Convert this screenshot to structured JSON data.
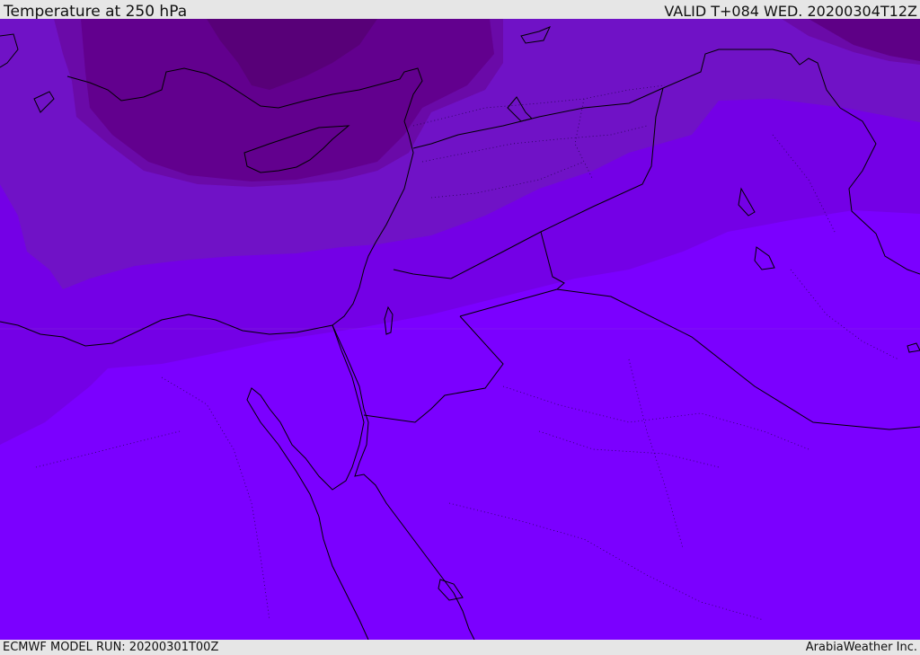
{
  "header": {
    "title": "Temperature at 250 hPa",
    "valid": "VALID T+084 WED. 20200304T12Z"
  },
  "footer": {
    "model_run": "ECMWF MODEL RUN: 20200301T00Z",
    "credit": "ArabiaWeather Inc."
  },
  "colors": {
    "band_warmest": "#7b00ff",
    "band_2": "#7400e6",
    "band_3": "#7012c6",
    "band_4": "#6a0aa8",
    "band_5": "#62008e",
    "band_coldest": "#580078",
    "coastline": "#000000",
    "border": "#000000"
  }
}
